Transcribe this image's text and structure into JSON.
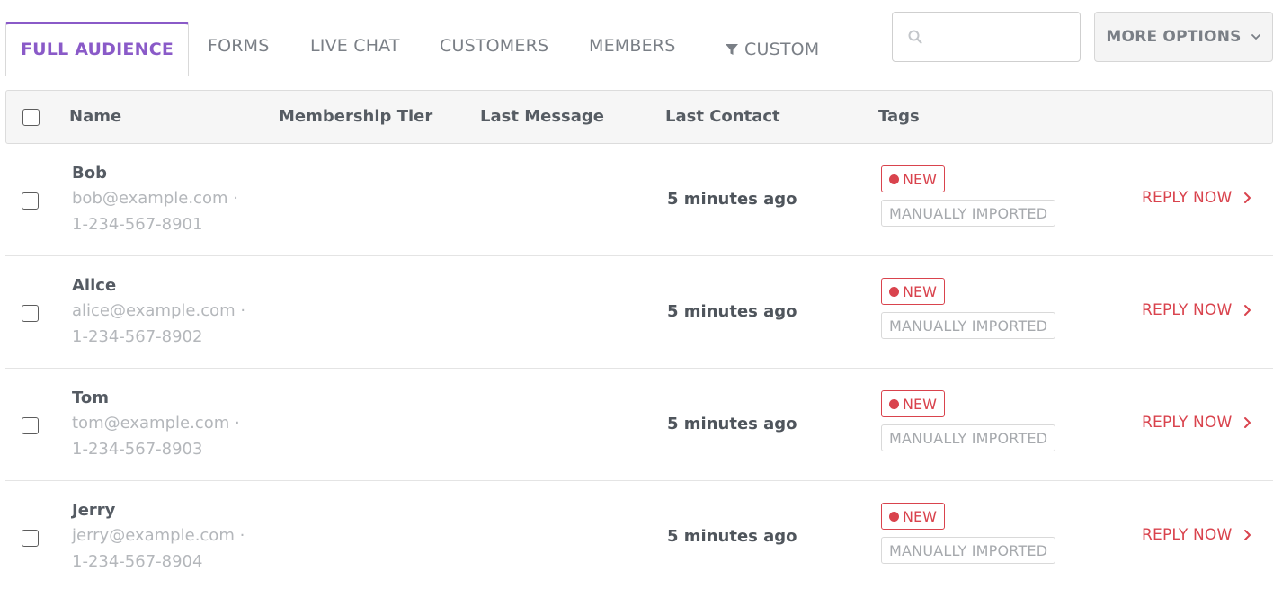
{
  "tabs": [
    {
      "label": "FULL AUDIENCE",
      "active": true
    },
    {
      "label": "FORMS"
    },
    {
      "label": "LIVE CHAT"
    },
    {
      "label": "CUSTOMERS"
    },
    {
      "label": "MEMBERS"
    },
    {
      "label": "CUSTOM",
      "icon": "filter-icon"
    }
  ],
  "search": {
    "placeholder": "",
    "icon": "search-icon"
  },
  "more_options": {
    "label": "MORE OPTIONS",
    "icon": "chevron-down-icon"
  },
  "table": {
    "headers": {
      "name": "Name",
      "membership_tier": "Membership Tier",
      "last_message": "Last Message",
      "last_contact": "Last Contact",
      "tags": "Tags"
    },
    "rows": [
      {
        "name": "Bob",
        "email": "bob@example.com ·",
        "phone": "1-234-567-8901",
        "last_contact": "5 minutes ago",
        "tag_new": "NEW",
        "tag_import": "MANUALLY IMPORTED",
        "action": "REPLY NOW"
      },
      {
        "name": "Alice",
        "email": "alice@example.com ·",
        "phone": "1-234-567-8902",
        "last_contact": "5 minutes ago",
        "tag_new": "NEW",
        "tag_import": "MANUALLY IMPORTED",
        "action": "REPLY NOW"
      },
      {
        "name": "Tom",
        "email": "tom@example.com ·",
        "phone": "1-234-567-8903",
        "last_contact": "5 minutes ago",
        "tag_new": "NEW",
        "tag_import": "MANUALLY IMPORTED",
        "action": "REPLY NOW"
      },
      {
        "name": "Jerry",
        "email": "jerry@example.com ·",
        "phone": "1-234-567-8904",
        "last_contact": "5 minutes ago",
        "tag_new": "NEW",
        "tag_import": "MANUALLY IMPORTED",
        "action": "REPLY NOW"
      }
    ]
  },
  "colors": {
    "accent_purple": "#8a5ac8",
    "alert_red": "#d9434d",
    "muted_text": "#b4b7bb"
  }
}
